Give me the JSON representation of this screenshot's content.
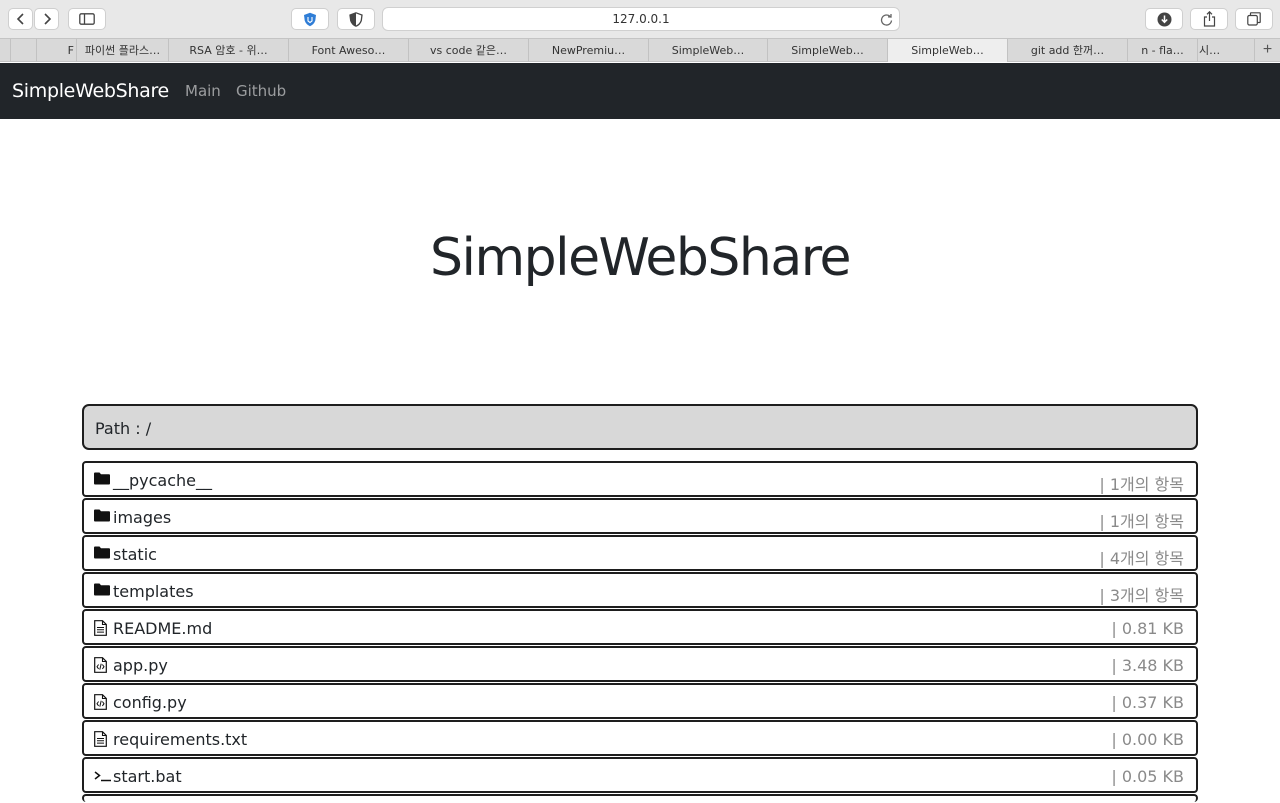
{
  "browser": {
    "url": "127.0.0.1",
    "tabs": [
      {
        "label": "F"
      },
      {
        "label": "파이썬 플라스…"
      },
      {
        "label": "RSA 암호 - 위…"
      },
      {
        "label": "Font Aweso…"
      },
      {
        "label": "vs code 같은…"
      },
      {
        "label": "NewPremiu…"
      },
      {
        "label": "SimpleWeb…"
      },
      {
        "label": "SimpleWeb…"
      },
      {
        "label": "SimpleWeb…"
      },
      {
        "label": "git add 한꺼…"
      },
      {
        "label": "n - fla…"
      },
      {
        "label": "시…"
      }
    ],
    "new_tab_label": "+"
  },
  "navbar": {
    "brand": "SimpleWebShare",
    "links": [
      "Main",
      "Github"
    ]
  },
  "hero": {
    "title": "SimpleWebShare"
  },
  "path": {
    "label": "Path : /"
  },
  "files": [
    {
      "name": "__pycache__",
      "meta": "| 1개의 항목",
      "icon": "folder-icon"
    },
    {
      "name": "images",
      "meta": "| 1개의 항목",
      "icon": "folder-icon"
    },
    {
      "name": "static",
      "meta": "| 4개의 항목",
      "icon": "folder-icon"
    },
    {
      "name": "templates",
      "meta": "| 3개의 항목",
      "icon": "folder-icon"
    },
    {
      "name": "README.md",
      "meta": "| 0.81 KB",
      "icon": "text-file-icon"
    },
    {
      "name": "app.py",
      "meta": "| 3.48 KB",
      "icon": "code-file-icon"
    },
    {
      "name": "config.py",
      "meta": "| 0.37 KB",
      "icon": "code-file-icon"
    },
    {
      "name": "requirements.txt",
      "meta": "| 0.00 KB",
      "icon": "text-file-icon"
    },
    {
      "name": "start.bat",
      "meta": "| 0.05 KB",
      "icon": "terminal-icon"
    }
  ]
}
